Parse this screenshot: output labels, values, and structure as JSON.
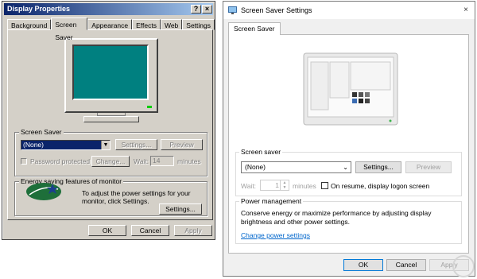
{
  "left_dialog": {
    "title": "Display Properties",
    "title_buttons": [
      "?",
      "×"
    ],
    "tabs": [
      "Background",
      "Screen Saver",
      "Appearance",
      "Effects",
      "Web",
      "Settings"
    ],
    "active_tab": "Screen Saver",
    "screen_saver_group": {
      "label": "Screen Saver",
      "selected": "(None)",
      "settings_button": "Settings...",
      "preview_button": "Preview",
      "password_label": "Password protected",
      "change_button": "Change...",
      "wait_label": "Wait:",
      "wait_value": "14",
      "minutes_label": "minutes"
    },
    "energy_group": {
      "label": "Energy saving features of monitor",
      "description": "To adjust the power settings for your monitor, click Settings.",
      "settings_button": "Settings..."
    },
    "footer": {
      "ok": "OK",
      "cancel": "Cancel",
      "apply": "Apply"
    },
    "colors": {
      "title_bar": "#0a246a",
      "preview_screen": "#008080"
    }
  },
  "right_dialog": {
    "title": "Screen Saver Settings",
    "close_glyph": "×",
    "tab": "Screen Saver",
    "screen_saver": {
      "label": "Screen saver",
      "selected": "(None)",
      "settings_button": "Settings...",
      "preview_button": "Preview",
      "wait_label": "Wait:",
      "wait_value": "1",
      "minutes_label": "minutes",
      "logon_label": "On resume, display logon screen"
    },
    "power": {
      "label": "Power management",
      "description": "Conserve energy or maximize performance by adjusting display brightness and other power settings.",
      "link": "Change power settings"
    },
    "footer": {
      "ok": "OK",
      "cancel": "Cancel",
      "apply": "Apply"
    },
    "colors": {
      "accent": "#0078d7",
      "link": "#0066cc"
    }
  }
}
